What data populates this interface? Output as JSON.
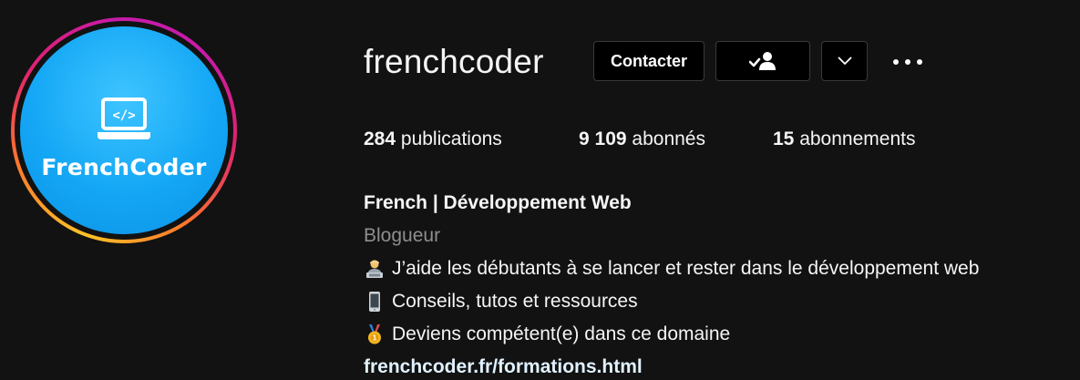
{
  "profile": {
    "username": "frenchcoder",
    "avatar_text": "FrenchCoder",
    "avatar_colors": {
      "ring_start": "#fdc327",
      "ring_mid": "#e0226f",
      "ring_end": "#c81ba9",
      "fill": "#14a7f5"
    }
  },
  "actions": {
    "contact_label": "Contacter",
    "following_icon": "person-check-icon",
    "dropdown_icon": "chevron-down-icon",
    "more_icon": "more-options-icon"
  },
  "stats": {
    "posts_count": "284",
    "posts_label": "publications",
    "followers_count": "9 109",
    "followers_label": "abonnés",
    "following_count": "15",
    "following_label": "abonnements"
  },
  "bio": {
    "name": "French | Développement Web",
    "category": "Blogueur",
    "lines": [
      {
        "icon": "technologist-emoji",
        "text": "J’aide les débutants à se lancer et rester dans le développement web"
      },
      {
        "icon": "mobile-phone-emoji",
        "text": "Conseils, tutos et ressources"
      },
      {
        "icon": "medal-emoji",
        "text": " Deviens compétent(e) dans ce domaine"
      }
    ],
    "link": "frenchcoder.fr/formations.html"
  }
}
